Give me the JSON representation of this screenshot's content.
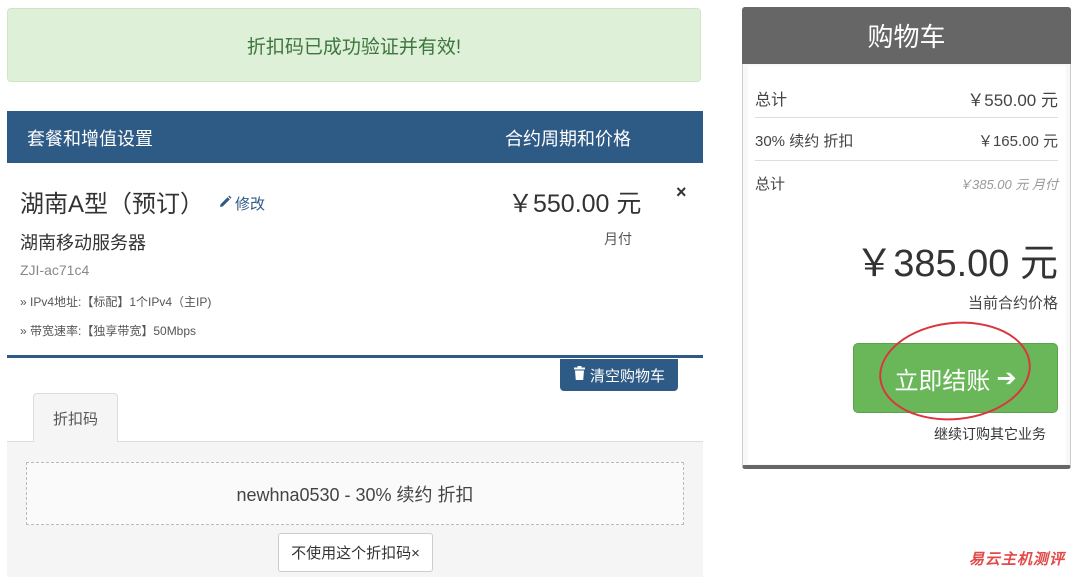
{
  "alert": {
    "message": "折扣码已成功验证并有效!"
  },
  "items_header": {
    "left_label": "套餐和增值设置",
    "right_label": "合约周期和价格"
  },
  "item": {
    "name": "湖南A型（预订）",
    "edit_label": "修改",
    "group": "湖南移动服务器",
    "domain": "ZJI-ac71c4",
    "config_1": "» IPv4地址:【标配】1个IPv4（主IP)",
    "config_2": "» 带宽速率:【独享带宽】50Mbps",
    "price": "￥550.00 元",
    "cycle": "月付",
    "remove_symbol": "×"
  },
  "empty_cart_label": "清空购物车",
  "promo": {
    "tab_label": "折扣码",
    "applied_text": "newhna0530 - 30% 续约 折扣",
    "remove_label": "不使用这个折扣码×"
  },
  "summary": {
    "title": "购物车",
    "rows": [
      {
        "label": "总计",
        "value": "￥550.00 元"
      },
      {
        "label": "30% 续约 折扣",
        "value": "￥165.00 元"
      },
      {
        "label": "总计",
        "value": "￥385.00 元 月付"
      }
    ],
    "total": "￥385.00 元",
    "total_caption": "当前合约价格",
    "checkout_label": "立即结账",
    "checkout_arrow": "➔",
    "continue_label": "继续订购其它业务"
  },
  "watermark": "易云主机测评",
  "colors": {
    "primary": "#2e5a86",
    "success_bg": "#dff0d8",
    "checkout": "#6ab75a",
    "summary_header": "#666666",
    "annotation": "#d9363e"
  }
}
